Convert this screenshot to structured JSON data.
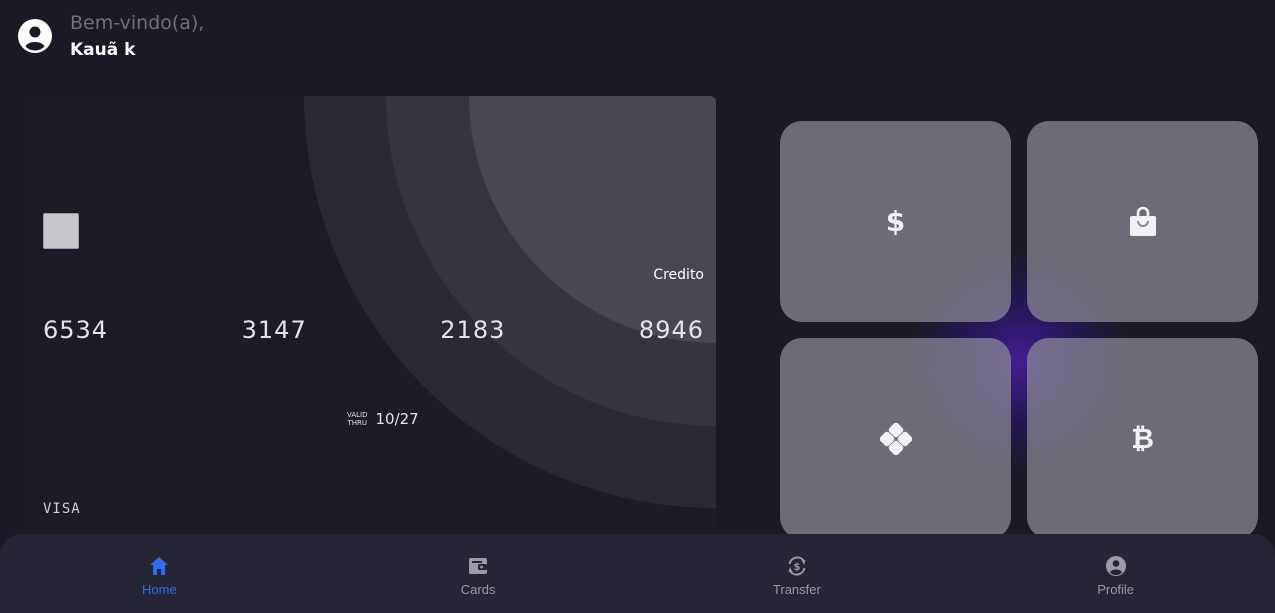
{
  "header": {
    "welcome": "Bem-vindo(a),",
    "username": "Kauã k",
    "avatar_icon": "user-circle-icon"
  },
  "card": {
    "type": "Credito",
    "number_groups": [
      "6534",
      "3147",
      "2183",
      "8946"
    ],
    "valid_label": "VALID\nTHRU",
    "valid_date": "10/27",
    "brand": "VISA"
  },
  "actions": [
    {
      "icon": "dollar-icon",
      "glyph": "$"
    },
    {
      "icon": "shopping-bag-icon",
      "glyph": "bag"
    },
    {
      "icon": "pix-icon",
      "glyph": "pix"
    },
    {
      "icon": "bitcoin-icon",
      "glyph": "₿"
    }
  ],
  "nav": {
    "items": [
      {
        "label": "Home",
        "icon": "home-icon",
        "active": true
      },
      {
        "label": "Cards",
        "icon": "wallet-icon",
        "active": false
      },
      {
        "label": "Transfer",
        "icon": "transfer-icon",
        "active": false
      },
      {
        "label": "Profile",
        "icon": "user-circle-icon",
        "active": false
      }
    ],
    "active_color": "#2f6bf2",
    "inactive_color": "#9a9aa6"
  }
}
